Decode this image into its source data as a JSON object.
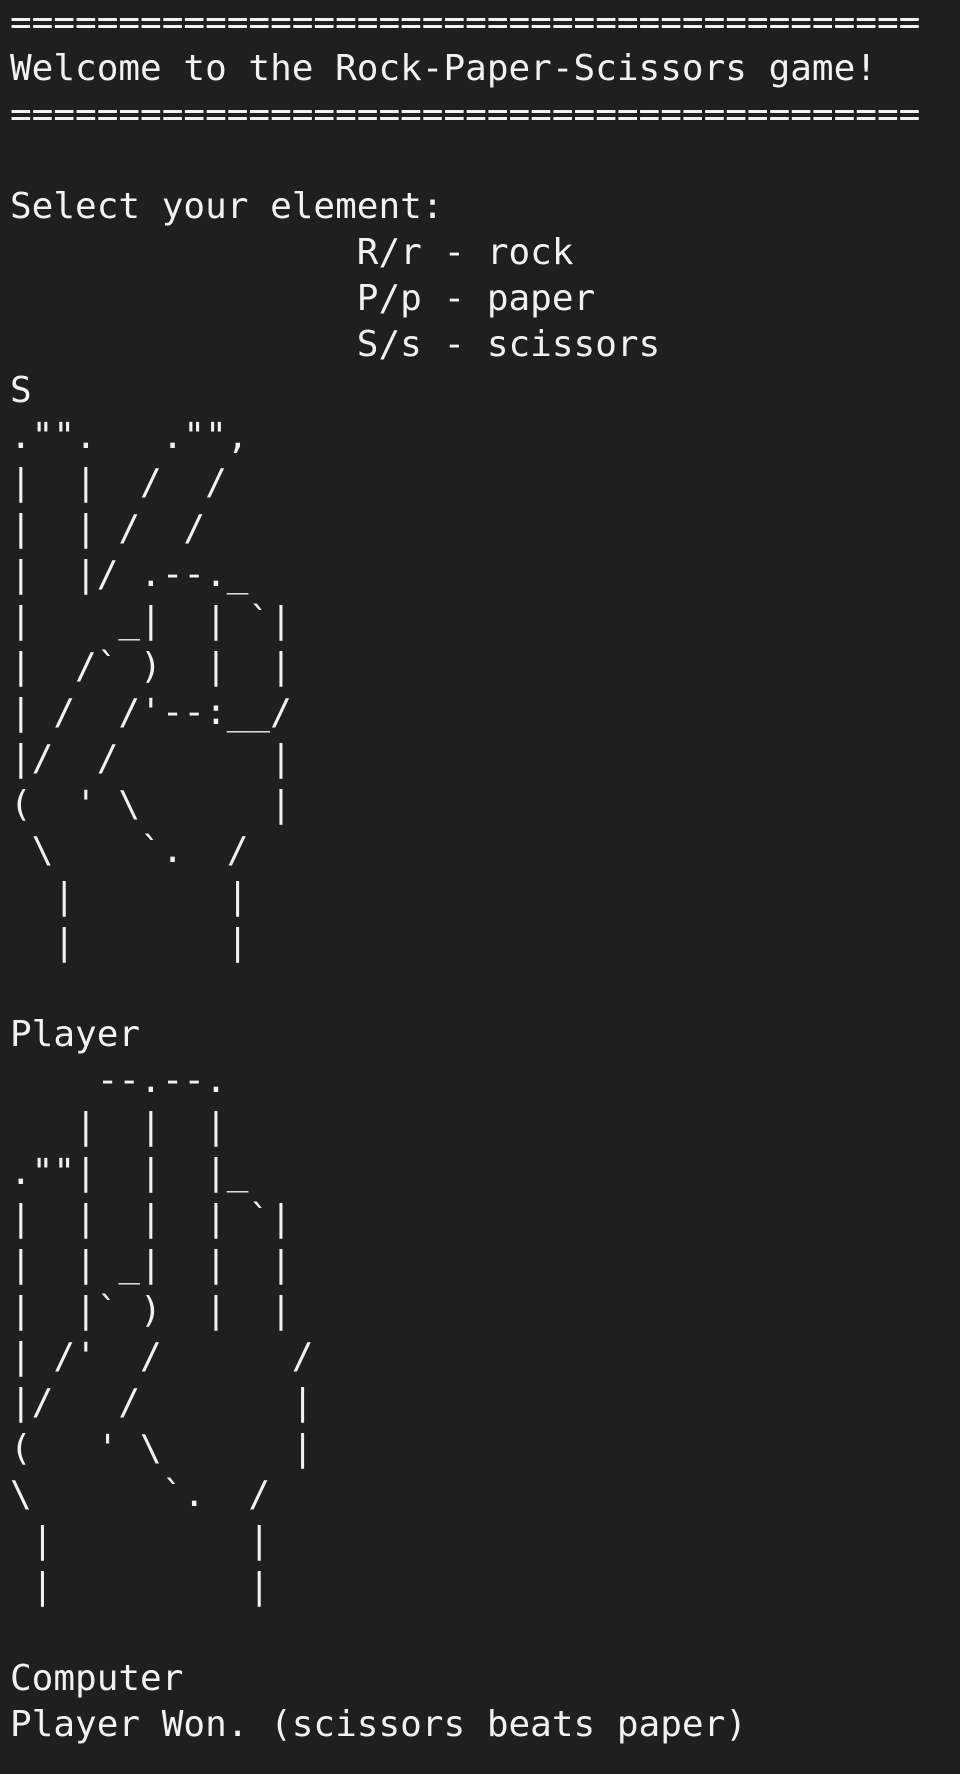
{
  "terminal": {
    "lines": [
      "==========================================",
      "Welcome to the Rock-Paper-Scissors game!",
      "==========================================",
      "",
      "Select your element:",
      "                R/r - rock",
      "                P/p - paper",
      "                S/s - scissors",
      "S",
      ".\"\".   .\"\",",
      "|  |  /  /",
      "|  | /  /",
      "|  |/ .--._",
      "|    _|  | `|",
      "|  /` )  |  |",
      "| /  /'--:__/",
      "|/  /       |",
      "(  ' \\      |",
      " \\    `.  /",
      "  |       |",
      "  |       |",
      "",
      "Player",
      "    --.--.",
      "   |  |  |",
      ".\"\"|  |  |_",
      "|  |  |  | `|",
      "|  | _|  |  |",
      "|  |` )  |  |",
      "| /'  /      /",
      "|/   /       |",
      "(   ' \\      |",
      "\\      `.  /",
      " |         |",
      " |         |",
      "",
      "Computer",
      "Player Won. (scissors beats paper)"
    ]
  }
}
